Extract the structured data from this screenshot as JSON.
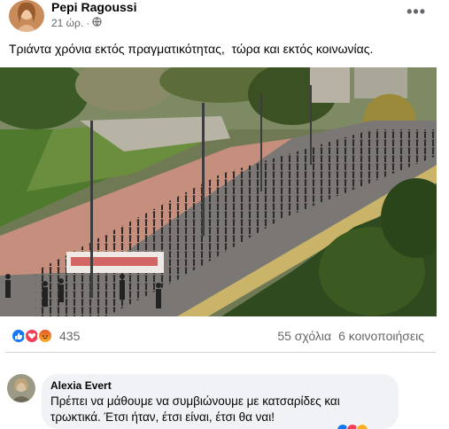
{
  "post": {
    "author": "Pepi Ragoussi",
    "time": "21 ώρ.",
    "privacy_icon": "globe-icon",
    "more_icon": "more-dots-icon",
    "more_label": "•••",
    "text": "Τριάντα χρόνια εκτός πραγματικότητας,  τώρα και εκτός κοινωνίας.",
    "photo_icon": "crowd-street-photo"
  },
  "reactions": {
    "icons": [
      "like-icon",
      "love-icon",
      "angry-icon"
    ],
    "colors": {
      "like": "#1877f2",
      "love": "#f33e58",
      "angry": "#f7b125"
    },
    "count": "435"
  },
  "stats": {
    "comments": "55 σχόλια",
    "shares": "6 κοινοποιήσεις"
  },
  "comment": {
    "author": "Alexia Evert",
    "line1": "Πρέπει να μάθουμε να συμβιώνουμε με κατσαρίδες και",
    "line2": "τρωκτικά. Έτσι ήταν, έτσι είναι, έτσι θα ναι!"
  }
}
